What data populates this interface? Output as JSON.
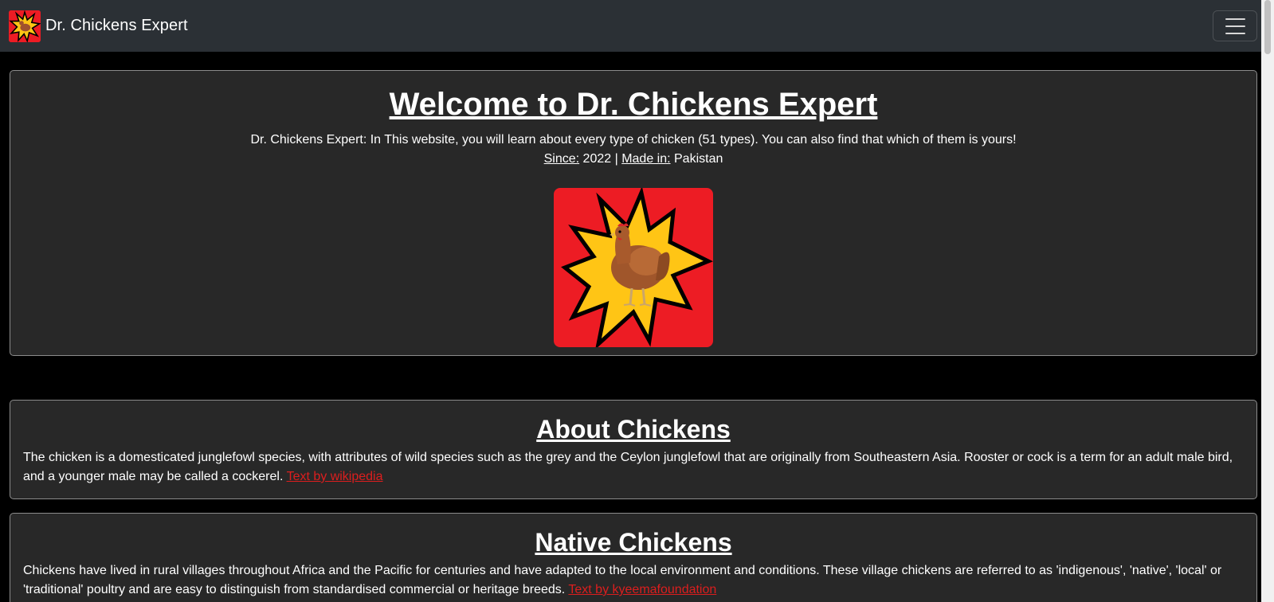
{
  "navbar": {
    "brand": "Dr. Chickens Expert",
    "logo_icon": "chicken-star-logo-icon",
    "menu_icon": "hamburger-menu-icon"
  },
  "hero": {
    "title": "Welcome to Dr. Chickens Expert",
    "description": "Dr. Chickens Expert: In This website, you will learn about every type of chicken (51 types). You can also find that which of them is yours!",
    "since_label": "Since:",
    "since_value": " 2022 | ",
    "made_label": "Made in:",
    "made_value": " Pakistan"
  },
  "about": {
    "title": "About Chickens",
    "text": "The chicken is a domesticated junglefowl species, with attributes of wild species such as the grey and the Ceylon junglefowl that are originally from Southeastern Asia. Rooster or cock is a term for an adult male bird, and a younger male may be called a cockerel. ",
    "link": "Text by wikipedia"
  },
  "native": {
    "title": "Native Chickens",
    "text": "Chickens have lived in rural villages throughout Africa and the Pacific for centuries and have adapted to the local environment and conditions. These village chickens are referred to as 'indigenous', 'native', 'local' or 'traditional' poultry and are easy to distinguish from standardised commercial or heritage breeds. ",
    "link": "Text by kyeemafoundation"
  },
  "colors": {
    "navbar_bg": "#2b3035",
    "card_bg": "#282828",
    "logo_red": "#ed1c24",
    "star_yellow": "#ffc515",
    "link_red": "#dc1e1e"
  }
}
